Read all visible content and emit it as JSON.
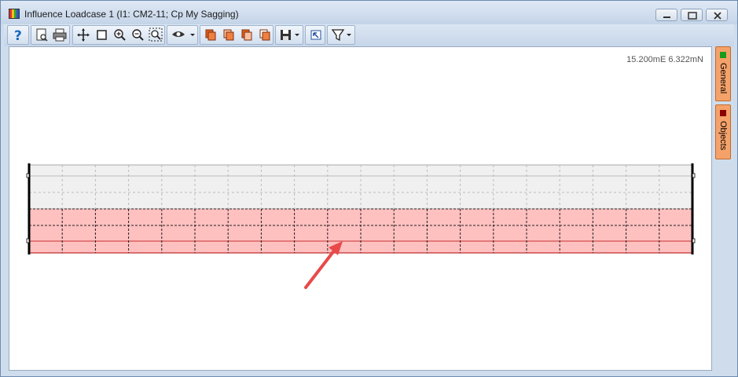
{
  "window": {
    "title": "Influence Loadcase 1 (I1: CM2-11; Cp My Sagging)",
    "controls": [
      "minimize",
      "restore",
      "close"
    ]
  },
  "toolbar": {
    "buttons": [
      {
        "name": "help-icon"
      },
      {
        "name": "print-preview-icon"
      },
      {
        "name": "print-icon"
      },
      {
        "name": "pan-icon"
      },
      {
        "name": "select-box-icon"
      },
      {
        "name": "zoom-in-icon"
      },
      {
        "name": "zoom-out-icon"
      },
      {
        "name": "zoom-extents-icon"
      },
      {
        "name": "view-dropdown-icon"
      },
      {
        "name": "copy-orange-1-icon"
      },
      {
        "name": "copy-orange-2-icon"
      },
      {
        "name": "copy-orange-3-icon"
      },
      {
        "name": "copy-orange-4-icon"
      },
      {
        "name": "save-dropdown-icon"
      },
      {
        "name": "reset-view-icon"
      },
      {
        "name": "filter-dropdown-icon"
      }
    ]
  },
  "canvas": {
    "coordinates": "15.200mE 6.322mN"
  },
  "side_tabs": [
    {
      "label": "General",
      "color": "#1a9b1a"
    },
    {
      "label": "Objects",
      "color": "#8b0000"
    }
  ],
  "colors": {
    "loaded_zone": "#ffc0c0",
    "unloaded_zone": "#f0f0f0",
    "annotation_arrow": "#e84a4a"
  }
}
